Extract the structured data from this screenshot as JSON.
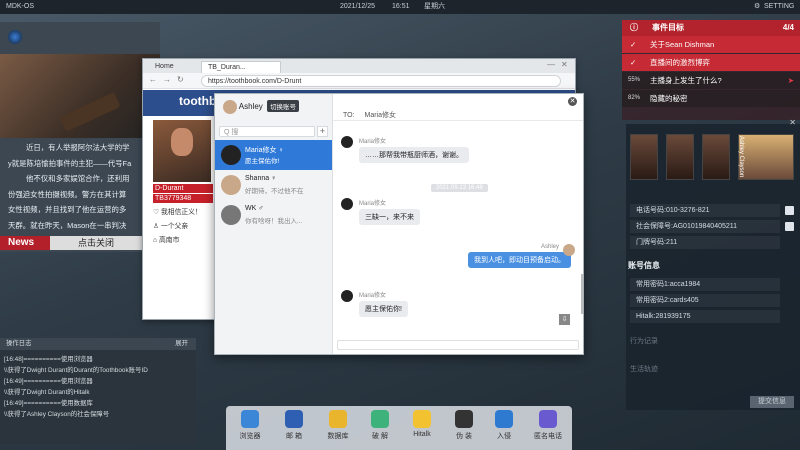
{
  "topbar": {
    "os": "MDK-OS",
    "date": "2021/12/25",
    "time": "16:51",
    "weekday": "星期六",
    "setting": "SETTING"
  },
  "news": {
    "lines": [
      "近日，有人举报阿尔法大学的学",
      "y就是陈培愉拍事件的主犯——代号Fa",
      "他不仅和多家娱馆合作，还利用",
      "份强迫女性拍摄视频。警方在其计算",
      "女性视频，并且找到了他在运营的多",
      "天群。就在昨天，Mason在一串判决"
    ],
    "tag": "News",
    "close": "点击关闭"
  },
  "log": {
    "title": "操作日志",
    "expand": "展开",
    "rows": [
      "[16:48]==========使用浏览器",
      "\\\\获得了Dwight Durant的Durant的Toothbook账号ID",
      "",
      "[16:49]==========使用浏览器",
      "\\\\获得了Dwight Durant的Hitalk",
      "",
      "[16:49]==========使用数据库",
      "\\\\获得了Ashley Clayson的社会保障号"
    ]
  },
  "browser": {
    "tab_home": "Home",
    "tab_active": "TB_Duran...",
    "url": "https://toothbook.com/D-Drunt",
    "brand": "toothb",
    "profile": {
      "name": "D-Durant",
      "id": "TB3779348",
      "meta1": "我相信正义！",
      "meta2": "一个父亲",
      "meta3": "高南市"
    }
  },
  "chat": {
    "me": "Ashley",
    "switch": "切换账号",
    "search": "Q 搜",
    "to": "TO:",
    "to_name": "Maria修女",
    "contacts": [
      {
        "name": "Maria修女 ♀",
        "msg": "愿主保佑你!"
      },
      {
        "name": "Shanna ♀",
        "msg": "好期待，不过他不在"
      },
      {
        "name": "WK ♂",
        "msg": "你有啥呀！我出入..."
      }
    ],
    "messages": [
      {
        "sender": "Maria修女",
        "text": "……那帮我带瓶厨师酒，谢谢。"
      },
      {
        "sender": "Maria修女",
        "text": "三缺一，来不来"
      },
      {
        "sender": "Ashley",
        "text": "我到人吧，即动目预备启动。"
      },
      {
        "sender": "Maria修女",
        "text": "愿主保佑你!"
      }
    ],
    "timestamp": "2021.09.13 16:48"
  },
  "events": {
    "title": "事件目标",
    "count": "4/4",
    "items": [
      {
        "text": "关于Sean Dishman",
        "pct": ""
      },
      {
        "text": "直播间的激烈博弈",
        "pct": ""
      },
      {
        "text": "主播身上发生了什么?",
        "pct": "55%"
      },
      {
        "text": "隐藏的秘密",
        "pct": "82%"
      }
    ]
  },
  "dossier": {
    "subject": "Ashley Clayson",
    "fields": [
      "电话号码:010-3276-821",
      "社会保障号:AG01019840405211",
      "门牌号码:211"
    ],
    "section": "账号信息",
    "accounts": [
      "常用密码1:acca1984",
      "常用密码2:cards405",
      "Hitalk:281939175"
    ],
    "ghost1": "行为记录",
    "ghost2": "生活轨迹",
    "submit": "提交信息"
  },
  "dock": [
    "浏览器",
    "邮 箱",
    "数据库",
    "破 解",
    "Hitalk",
    "伪 装",
    "入侵",
    "匿名电话"
  ],
  "colors": {
    "accent_red": "#c62a34",
    "accent_blue": "#2f7ad9"
  }
}
